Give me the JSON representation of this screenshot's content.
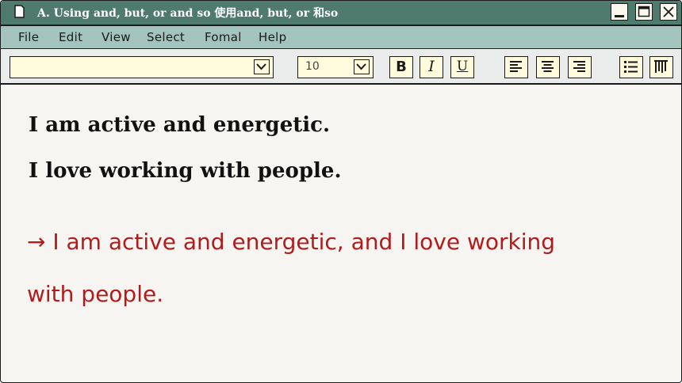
{
  "window": {
    "title": "A. Using and, but, or and so 使用and, but, or 和so",
    "doc_icon": "document-icon",
    "controls": [
      "minimize-icon",
      "maximize-icon",
      "close-icon"
    ]
  },
  "menu": {
    "items": [
      "File",
      "Edit",
      "View",
      "Select",
      "Fomal",
      "Help"
    ]
  },
  "toolbar": {
    "font_value": "",
    "size_value": "10",
    "bold_label": "B",
    "italic_label": "I",
    "underline_label": "U",
    "icons": [
      "align-left-icon",
      "align-center-icon",
      "align-right-icon",
      "bullet-list-icon",
      "columns-icon"
    ]
  },
  "content": {
    "sentence_1": "I am active and energetic.",
    "sentence_2": "I love working with people.",
    "answer_line_1": "→ I am active and energetic, and I love working",
    "answer_line_2": "with people."
  },
  "colors": {
    "titlebar": "#4f7b6f",
    "menubar": "#a3c3bd",
    "answer_text": "#b21b1b",
    "field_background": "#fffbdc"
  }
}
